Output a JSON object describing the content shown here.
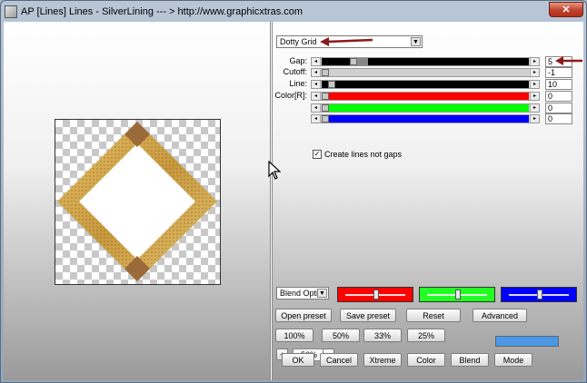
{
  "window": {
    "title": "AP [Lines]  Lines - SilverLining    --- > http://www.graphicxtras.com",
    "close_label": "✕"
  },
  "pattern": {
    "selected": "Dotty Grid"
  },
  "params": [
    {
      "label": "Gap:",
      "value": "5",
      "fraction": 0.14
    },
    {
      "label": "Cutoff:",
      "value": "-1",
      "fraction": 0.0
    },
    {
      "label": "Line:",
      "value": "10",
      "fraction": 0.03
    },
    {
      "label": "Color[R]:",
      "value": "0",
      "fraction": 0.0,
      "color": "#ff0000"
    },
    {
      "label": "",
      "value": "0",
      "fraction": 0.0,
      "color": "#00ff00"
    },
    {
      "label": "",
      "value": "0",
      "fraction": 0.0,
      "color": "#0000ff"
    }
  ],
  "option": {
    "create_lines_label": "Create lines not gaps",
    "checked": true,
    "check_mark": "✓"
  },
  "blend": {
    "selected": "Blend Opti"
  },
  "color_bars": [
    {
      "color": "#ff0000",
      "fraction": 0.5
    },
    {
      "color": "#22ff22",
      "fraction": 0.5
    },
    {
      "color": "#0000ff",
      "fraction": 0.5
    }
  ],
  "buttons": {
    "open_preset": "Open preset",
    "save_preset": "Save preset",
    "reset": "Reset",
    "advanced": "Advanced",
    "zoom100": "100%",
    "zoom50": "50%",
    "zoom33": "33%",
    "zoom25": "25%",
    "plus": "+",
    "minus": "–",
    "ok": "OK",
    "cancel": "Cancel",
    "xtreme": "Xtreme",
    "color": "Color",
    "blend": "Blend",
    "mode": "Mode"
  },
  "zoom": {
    "value": "50%"
  },
  "accent": {
    "swatch": "#4a97e6",
    "annotation_arrow": "#8b1a1a"
  }
}
